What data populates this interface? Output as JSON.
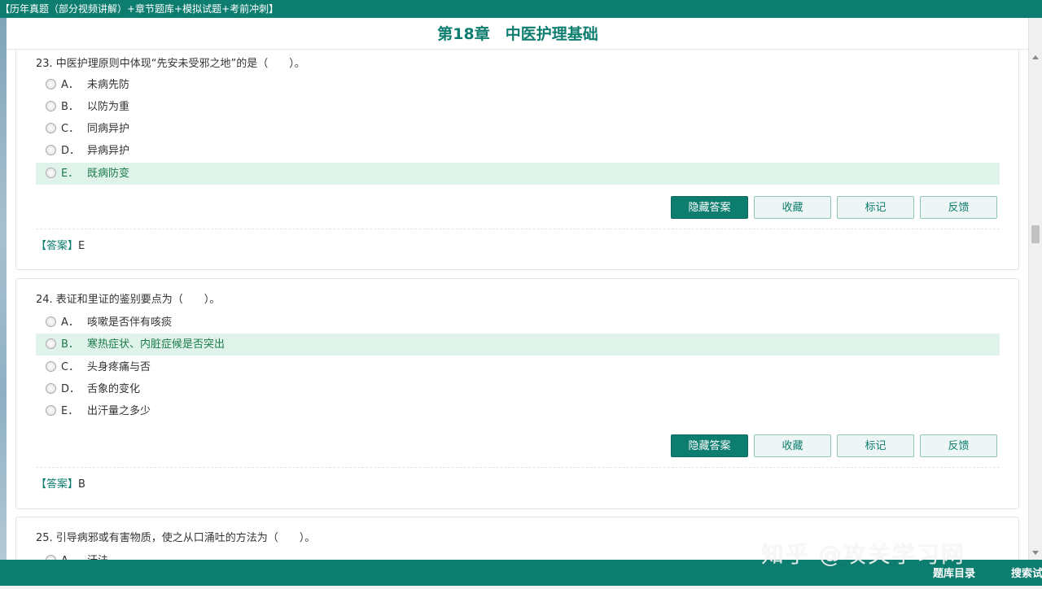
{
  "top_bar": {
    "text": "【历年真题（部分视频讲解）+章节题库+模拟试题+考前冲刺】"
  },
  "chapter_title": "第18章　中医护理基础",
  "questions": [
    {
      "number_text": "23. 中医护理原则中体现“先安未受邪之地”的是（　　）。",
      "options": [
        {
          "letter": "A．",
          "text": "未病先防"
        },
        {
          "letter": "B．",
          "text": "以防为重"
        },
        {
          "letter": "C．",
          "text": "同病异护"
        },
        {
          "letter": "D．",
          "text": "异病异护"
        },
        {
          "letter": "E．",
          "text": "既病防变"
        }
      ],
      "correct_index": 4,
      "answer_tag": "【答案】",
      "answer_value": "E"
    },
    {
      "number_text": "24. 表证和里证的鉴别要点为（　　）。",
      "options": [
        {
          "letter": "A．",
          "text": "咳嗽是否伴有咳痰"
        },
        {
          "letter": "B．",
          "text": "寒热症状、内脏症候是否突出"
        },
        {
          "letter": "C．",
          "text": "头身疼痛与否"
        },
        {
          "letter": "D．",
          "text": "舌象的变化"
        },
        {
          "letter": "E．",
          "text": "出汗量之多少"
        }
      ],
      "correct_index": 1,
      "answer_tag": "【答案】",
      "answer_value": "B"
    },
    {
      "number_text": "25. 引导病邪或有害物质，使之从口涌吐的方法为（　　）。",
      "options": [
        {
          "letter": "A．",
          "text": "汗法"
        }
      ]
    }
  ],
  "buttons": {
    "hide_answer": "隐藏答案",
    "favorite": "收藏",
    "mark": "标记",
    "feedback": "反馈"
  },
  "bottom_bar": {
    "catalog": "题库目录",
    "search": "搜索试"
  },
  "watermark": "知乎 @攻关学习网",
  "colors": {
    "brand": "#0d7d6f",
    "correct_bg": "#dff3ea",
    "correct_text": "#1c7b4a"
  }
}
